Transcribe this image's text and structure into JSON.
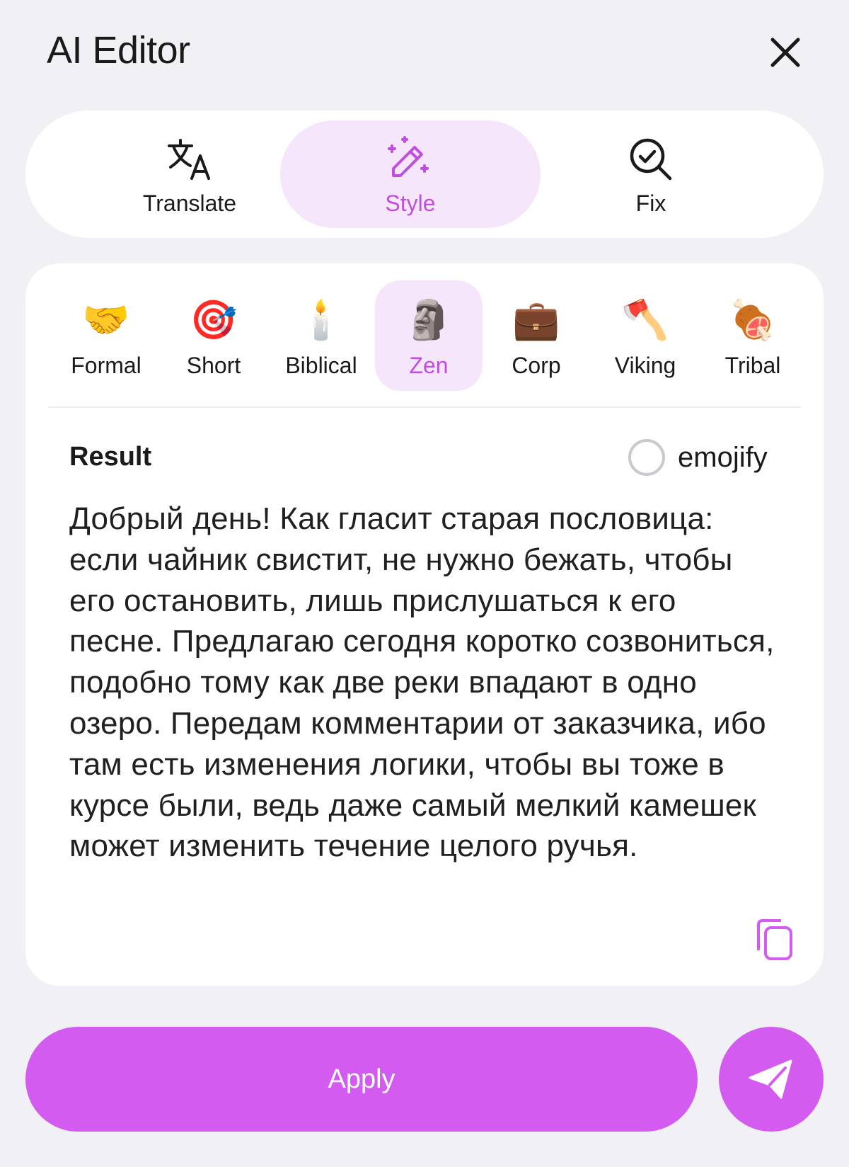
{
  "header": {
    "title": "AI Editor",
    "close_icon": "close-icon"
  },
  "modes": [
    {
      "label": "Translate",
      "icon": "translate-icon",
      "active": false
    },
    {
      "label": "Style",
      "icon": "magic-wand-icon",
      "active": true
    },
    {
      "label": "Fix",
      "icon": "search-check-icon",
      "active": false
    }
  ],
  "styles": [
    {
      "label": "Formal",
      "emoji": "🤝",
      "active": false
    },
    {
      "label": "Short",
      "emoji": "🎯",
      "active": false
    },
    {
      "label": "Biblical",
      "emoji": "🕯️",
      "active": false
    },
    {
      "label": "Zen",
      "emoji": "🗿",
      "active": true
    },
    {
      "label": "Corp",
      "emoji": "💼",
      "active": false
    },
    {
      "label": "Viking",
      "emoji": "🪓",
      "active": false
    },
    {
      "label": "Tribal",
      "emoji": "🍖",
      "active": false
    }
  ],
  "result": {
    "label": "Result",
    "emojify_label": "emojify",
    "emojify_checked": false,
    "text": "Добрый день! Как гласит старая пословица: если чайник свистит, не нужно бежать, чтобы его остановить, лишь прислушаться к его песне. Предлагаю сегодня коротко созвониться, подобно тому как две реки впадают в одно озеро. Передам комментарии от заказчика, ибо там есть изменения логики, чтобы вы тоже в курсе были, ведь даже самый мелкий камешек может изменить течение целого ручья."
  },
  "actions": {
    "apply_label": "Apply",
    "send_icon": "send-icon",
    "copy_icon": "copy-icon"
  },
  "colors": {
    "accent": "#d45bf0",
    "accent_text": "#c04ee0",
    "active_bg": "#f6e6fb",
    "page_bg": "#f1f0f5"
  }
}
